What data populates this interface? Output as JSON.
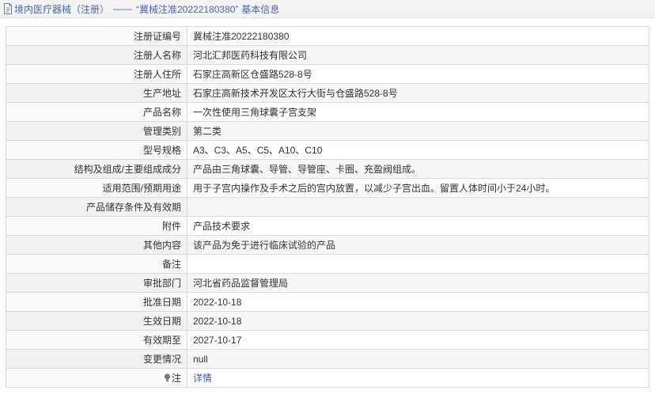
{
  "breadcrumb": {
    "category": "境内医疗器械（注册）",
    "separator": "——",
    "record": "“冀械注准20222180380”",
    "section": "基本信息"
  },
  "rows": [
    {
      "label": "注册证编号",
      "value": "冀械注准20222180380"
    },
    {
      "label": "注册人名称",
      "value": "河北汇邦医药科技有限公司"
    },
    {
      "label": "注册人住所",
      "value": "石家庄高新区仓盛路528-8号"
    },
    {
      "label": "生产地址",
      "value": "石家庄高新技术开发区太行大街与仓盛路528-8号"
    },
    {
      "label": "产品名称",
      "value": "一次性使用三角球囊子宫支架"
    },
    {
      "label": "管理类别",
      "value": "第二类"
    },
    {
      "label": "型号规格",
      "value": "A3、C3、A5、C5、A10、C10"
    },
    {
      "label": "结构及组成/主要组成成分",
      "value": "产品由三角球囊、导管、导管座、卡圈、充盈阀组成。"
    },
    {
      "label": "适用范围/预期用途",
      "value": "用于子宫内操作及手术之后的宫内放置，以减少子宫出血。留置人体时间小于24小时。"
    },
    {
      "label": "产品储存条件及有效期",
      "value": ""
    },
    {
      "label": "附件",
      "value": "产品技术要求"
    },
    {
      "label": "其他内容",
      "value": "该产品为免于进行临床试验的产品"
    },
    {
      "label": "备注",
      "value": ""
    },
    {
      "label": "审批部门",
      "value": "河北省药品监督管理局"
    },
    {
      "label": "批准日期",
      "value": "2022-10-18"
    },
    {
      "label": "生效日期",
      "value": "2022-10-18"
    },
    {
      "label": "有效期至",
      "value": "2027-10-17"
    },
    {
      "label": "变更情况",
      "value": "null"
    }
  ],
  "note_row": {
    "label": "注",
    "link": "详情"
  },
  "icons": {
    "title": "document-icon",
    "note": "lightbulb-icon"
  }
}
